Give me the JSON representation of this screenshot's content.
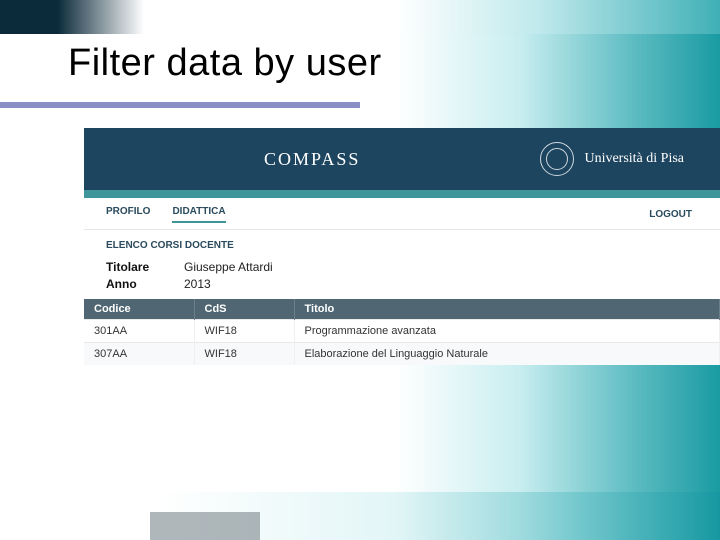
{
  "slide": {
    "title": "Filter data by user"
  },
  "app": {
    "brand": "COMPASS",
    "university": "Università di Pisa",
    "nav": {
      "profilo": "PROFILO",
      "didattica": "DIDATTICA",
      "logout": "LOGOUT"
    },
    "section_title": "ELENCO CORSI DOCENTE",
    "meta": {
      "titolare_label": "Titolare",
      "titolare_value": "Giuseppe Attardi",
      "anno_label": "Anno",
      "anno_value": "2013"
    },
    "table": {
      "headers": {
        "codice": "Codice",
        "cds": "CdS",
        "titolo": "Titolo"
      },
      "rows": [
        {
          "codice": "301AA",
          "cds": "WIF18",
          "titolo": "Programmazione avanzata"
        },
        {
          "codice": "307AA",
          "cds": "WIF18",
          "titolo": "Elaborazione del Linguaggio Naturale"
        }
      ]
    }
  }
}
